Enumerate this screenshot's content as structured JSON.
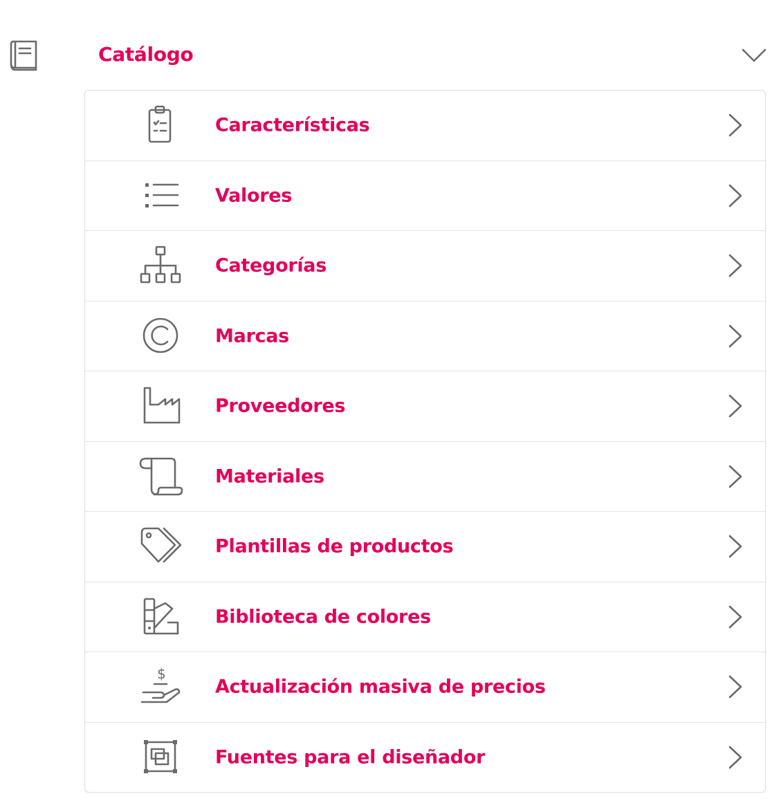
{
  "section": {
    "title": "Catálogo",
    "icon": "book-icon",
    "expanded": true
  },
  "colors": {
    "accent": "#e4005a",
    "icon": "#6a6a6a",
    "border": "#dcdcdc"
  },
  "menu_items": [
    {
      "label": "Características",
      "icon": "clipboard-checklist-icon"
    },
    {
      "label": "Valores",
      "icon": "list-icon"
    },
    {
      "label": "Categorías",
      "icon": "hierarchy-icon"
    },
    {
      "label": "Marcas",
      "icon": "copyright-icon"
    },
    {
      "label": "Proveedores",
      "icon": "factory-icon"
    },
    {
      "label": "Materiales",
      "icon": "scroll-icon"
    },
    {
      "label": "Plantillas de productos",
      "icon": "tags-icon"
    },
    {
      "label": "Biblioteca de colores",
      "icon": "color-swatch-icon"
    },
    {
      "label": "Actualización masiva de precios",
      "icon": "hand-dollar-icon"
    },
    {
      "label": "Fuentes para el diseñador",
      "icon": "font-frame-icon"
    }
  ]
}
